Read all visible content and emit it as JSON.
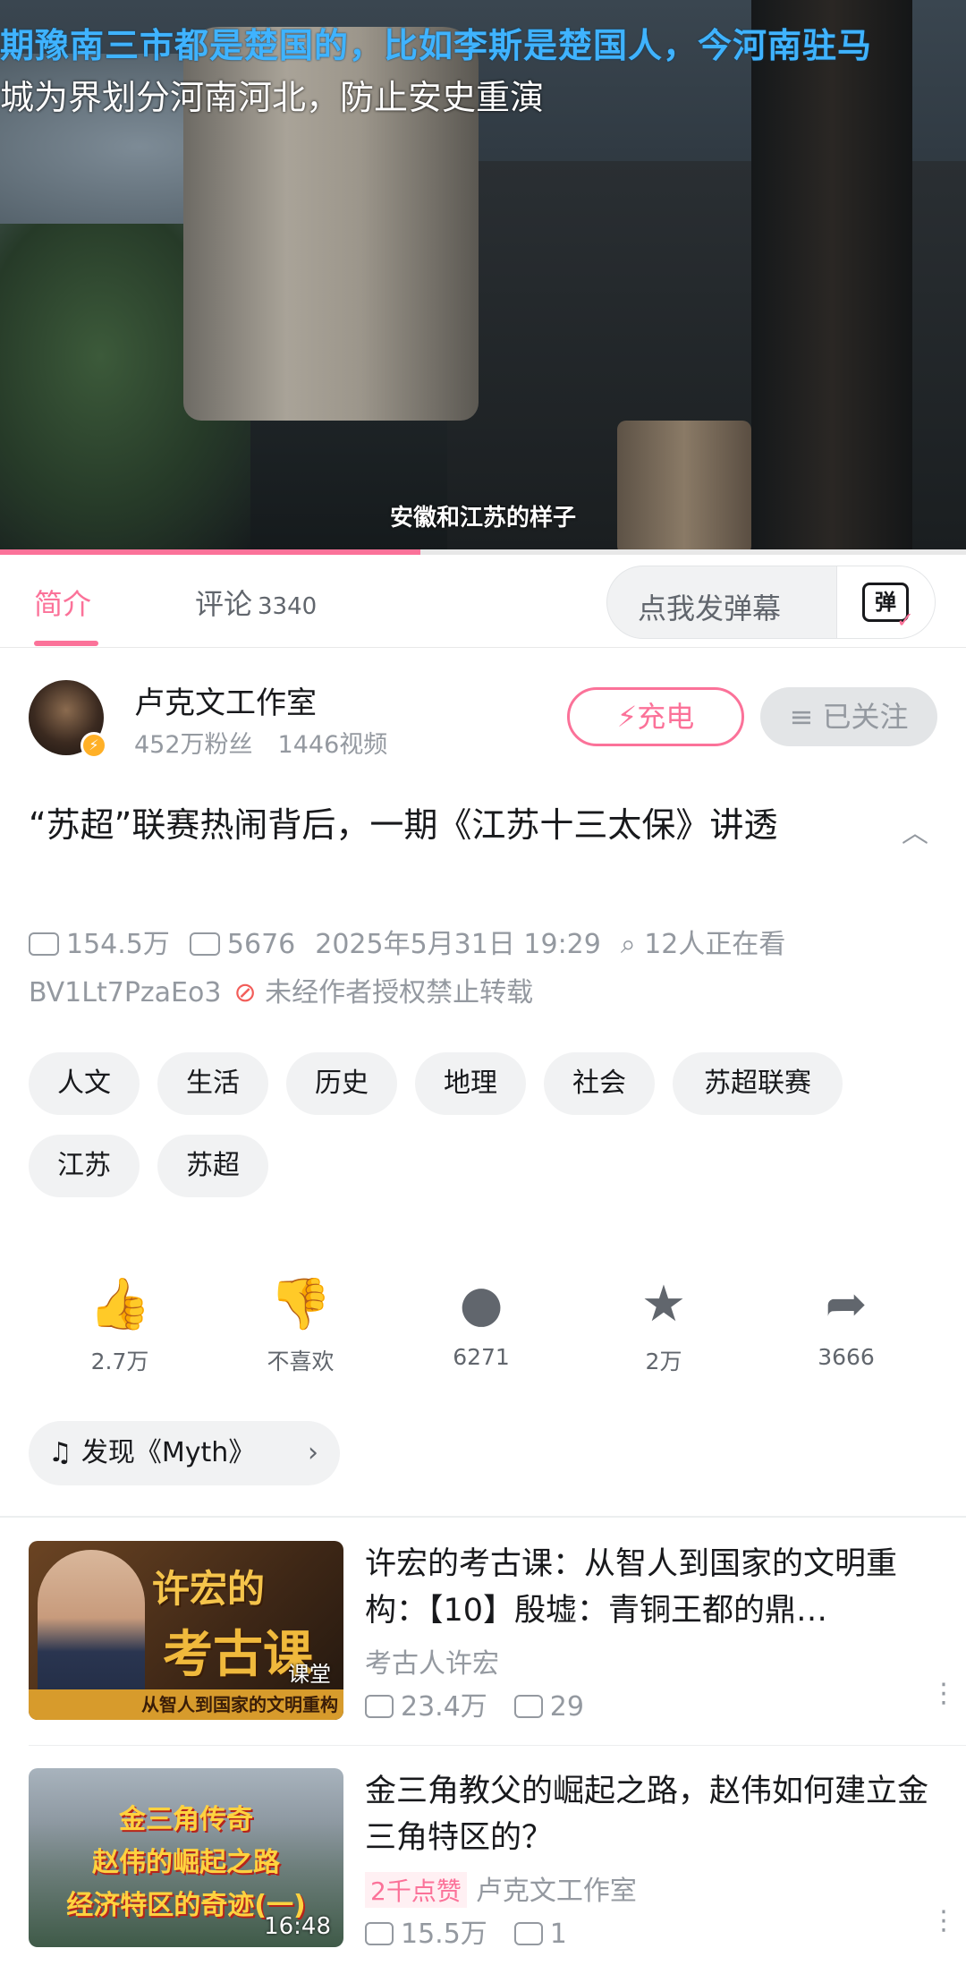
{
  "video": {
    "danmaku": "期豫南三市都是楚国的，比如李斯是楚国人，今河南驻马",
    "subtitle_top": "城为界划分河南河北，防止安史重演",
    "caption": "安徽和江苏的样子",
    "progress": 0.435
  },
  "tabs": {
    "intro": "简介",
    "comments": "评论",
    "comments_count": "3340",
    "danmaku_placeholder": "点我发弹幕",
    "danmaku_button": "弹"
  },
  "author": {
    "name": "卢克文工作室",
    "fans": "452万粉丝",
    "videos": "1446视频",
    "charge": "充电",
    "follow": "已关注"
  },
  "video_info": {
    "title": "“苏超”联赛热闹背后，一期《江苏十三太保》讲透",
    "views": "154.5万",
    "danmaku_count": "5676",
    "date": "2025年5月31日 19:29",
    "watching": "12人正在看",
    "bvid": "BV1Lt7PzaEo3",
    "no_repost": "未经作者授权禁止转载"
  },
  "tags": [
    "人文",
    "生活",
    "历史",
    "地理",
    "社会",
    "苏超联赛",
    "江苏",
    "苏超"
  ],
  "actions": {
    "like": "2.7万",
    "dislike": "不喜欢",
    "coin": "6271",
    "favorite": "2万",
    "share": "3666"
  },
  "music": "发现《Myth》",
  "recommendations": [
    {
      "title": "许宏的考古课：从智人到国家的文明重构：【10】殷墟：青铜王都的鼎…",
      "author": "考古人许宏",
      "views": "23.4万",
      "danmaku": "29",
      "thumb_badge": "课堂",
      "thumb_line1": "许宏的",
      "thumb_line2": "考古课",
      "thumb_band": "从智人到国家的文明重构"
    },
    {
      "title": "金三角教父的崛起之路，赵伟如何建立金三角特区的？",
      "hot": "2千点赞",
      "author": "卢克文工作室",
      "views": "15.5万",
      "danmaku": "1",
      "duration": "16:48",
      "thumb_lines": [
        "金三角传奇",
        "赵伟的崛起之路",
        "经济特区的奇迹(一)"
      ]
    }
  ]
}
